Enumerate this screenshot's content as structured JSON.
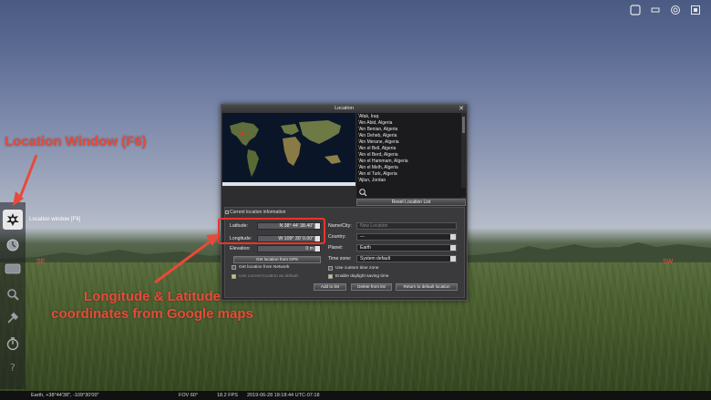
{
  "top_toolbar": {
    "icons": [
      "window-icon",
      "minimize-icon",
      "target-icon",
      "fullscreen-icon"
    ]
  },
  "left_toolbar": {
    "items": [
      {
        "icon": "location-window-icon",
        "active": true
      },
      {
        "icon": "date-time-icon",
        "active": false
      },
      {
        "icon": "sky-viewing-icon",
        "active": false
      },
      {
        "icon": "search-icon",
        "active": false
      },
      {
        "icon": "configuration-icon",
        "active": false
      },
      {
        "icon": "astronomical-calculations-icon",
        "active": false
      },
      {
        "icon": "help-icon",
        "active": false
      }
    ],
    "tooltip": "Location window  [F6]"
  },
  "cardinals": {
    "left": "SE",
    "right": "SW"
  },
  "status_bar": {
    "location": "Earth, +38°44'38\", -109°30'00\"",
    "fov": "FOV 60°",
    "fps": "18.2 FPS",
    "datetime": "2019-06-28 18:18:44 UTC-07:18"
  },
  "location_window": {
    "title": "Location",
    "cities": [
      "'Afak, Iraq",
      "'Ain Abid, Algeria",
      "'Ain Benian, Algeria",
      "'Ain Deheb, Algeria",
      "'Ain Merane, Algeria",
      "'Ain el Bell, Algeria",
      "'Ain el Berd, Algeria",
      "'Ain el Hammam, Algeria",
      "'Ain el Melh, Algeria",
      "'Ain el Turk, Algeria",
      "'Ajlun, Jordan"
    ],
    "reset_button": "Reset Location List",
    "current_info_label": "Current location information",
    "latitude_label": "Latitude:",
    "latitude_value": "N 38° 44' 38.40\"",
    "longitude_label": "Longitude:",
    "longitude_value": "W 109° 30' 0.00\"",
    "elevation_label": "Elevation:",
    "elevation_value": "0 m",
    "gps_button": "Get location from GPS",
    "network_checkbox": "Get location from Network",
    "default_checkbox": "Use current location as default",
    "name_label": "Name/City:",
    "name_placeholder": "New Location",
    "country_label": "Country:",
    "country_value": "---",
    "planet_label": "Planet:",
    "planet_value": "Earth",
    "timezone_label": "Time zone:",
    "timezone_value": "System default",
    "custom_tz_checkbox": "Use custom time zone",
    "dst_checkbox": "Enable daylight saving time",
    "add_button": "Add to list",
    "delete_button": "Delete from list",
    "return_button": "Return to default location"
  },
  "annotations": {
    "title": "Location Window (F6)",
    "coords": "Longitude & Latitude coordinates from Google maps"
  },
  "colors": {
    "annotation": "#e84a3a",
    "panel": "#2d2d2f",
    "highlight_box": "#e8352a"
  }
}
